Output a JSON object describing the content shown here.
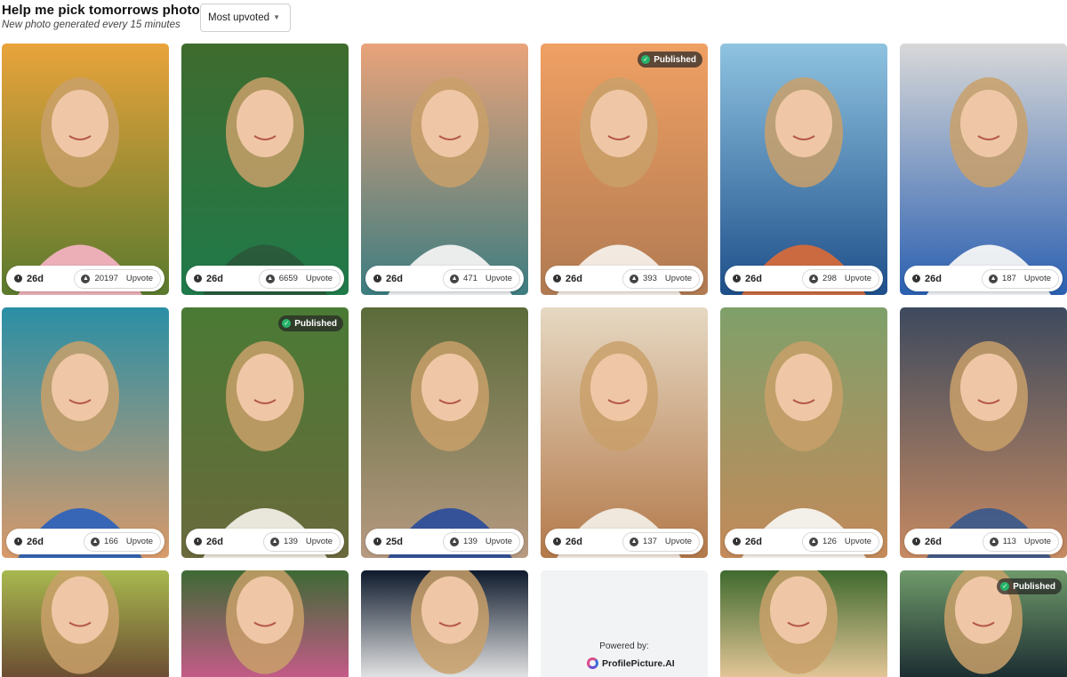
{
  "header": {
    "title": "Help me pick tomorrows photo",
    "subtitle": "New photo generated every 15 minutes"
  },
  "sort": {
    "selected": "Most upvoted"
  },
  "upvote_label": "Upvote",
  "published_label": "Published",
  "powered": {
    "label": "Powered by:",
    "brand": "ProfilePicture.AI"
  },
  "cards": [
    {
      "row": 0,
      "col": 0,
      "age": "26d",
      "votes": "20197",
      "published": false,
      "palette": [
        "#e9a33b",
        "#5a7a2e",
        "#f3b1bf"
      ]
    },
    {
      "row": 0,
      "col": 1,
      "age": "26d",
      "votes": "6659",
      "published": false,
      "palette": [
        "#3f6b2e",
        "#1f7a4a",
        "#2a5a3b"
      ]
    },
    {
      "row": 0,
      "col": 2,
      "age": "26d",
      "votes": "471",
      "published": false,
      "palette": [
        "#e9a37a",
        "#3c7c80",
        "#f2f2f2"
      ]
    },
    {
      "row": 0,
      "col": 3,
      "age": "26d",
      "votes": "393",
      "published": true,
      "palette": [
        "#f0a063",
        "#b07a52",
        "#f4eee8"
      ]
    },
    {
      "row": 0,
      "col": 4,
      "age": "26d",
      "votes": "298",
      "published": false,
      "palette": [
        "#8fc3e0",
        "#1e4f8a",
        "#d46a3c"
      ]
    },
    {
      "row": 0,
      "col": 5,
      "age": "26d",
      "votes": "187",
      "published": false,
      "palette": [
        "#d8d8d8",
        "#2a5fb0",
        "#f6f6f6"
      ]
    },
    {
      "row": 1,
      "col": 0,
      "age": "26d",
      "votes": "166",
      "published": false,
      "palette": [
        "#2a8fa6",
        "#d99a6a",
        "#2e63b8"
      ]
    },
    {
      "row": 1,
      "col": 1,
      "age": "26d",
      "votes": "139",
      "published": true,
      "palette": [
        "#4a7a34",
        "#6a6a3c",
        "#f0ede4"
      ]
    },
    {
      "row": 1,
      "col": 2,
      "age": "25d",
      "votes": "139",
      "published": false,
      "palette": [
        "#5b6b3a",
        "#b79a82",
        "#2e4f9a"
      ]
    },
    {
      "row": 1,
      "col": 3,
      "age": "26d",
      "votes": "137",
      "published": false,
      "palette": [
        "#e6d8c2",
        "#b3794a",
        "#f2ece4"
      ]
    },
    {
      "row": 1,
      "col": 4,
      "age": "26d",
      "votes": "126",
      "published": false,
      "palette": [
        "#7fa06a",
        "#c48a5a",
        "#f5f5f0"
      ]
    },
    {
      "row": 1,
      "col": 5,
      "age": "26d",
      "votes": "113",
      "published": false,
      "palette": [
        "#3d4a5e",
        "#c78a62",
        "#3e5a8a"
      ]
    },
    {
      "row": 2,
      "col": 0,
      "age": "",
      "votes": "",
      "published": false,
      "palette": [
        "#a8b84e",
        "#6a4a32",
        "#e8cfa8"
      ]
    },
    {
      "row": 2,
      "col": 1,
      "age": "",
      "votes": "",
      "published": false,
      "palette": [
        "#3e6a35",
        "#c85a8a",
        "#7a6a5a"
      ]
    },
    {
      "row": 2,
      "col": 2,
      "age": "",
      "votes": "",
      "published": false,
      "palette": [
        "#0e1a2c",
        "#e8e8e8",
        "#c78a62"
      ]
    },
    {
      "row": 2,
      "col": 4,
      "age": "",
      "votes": "",
      "published": false,
      "palette": [
        "#3f6a2e",
        "#e8c89a",
        "#5a3a2a"
      ]
    },
    {
      "row": 2,
      "col": 5,
      "age": "",
      "votes": "",
      "published": true,
      "palette": [
        "#6f9a6a",
        "#1a2a30",
        "#e8c89a"
      ]
    }
  ]
}
